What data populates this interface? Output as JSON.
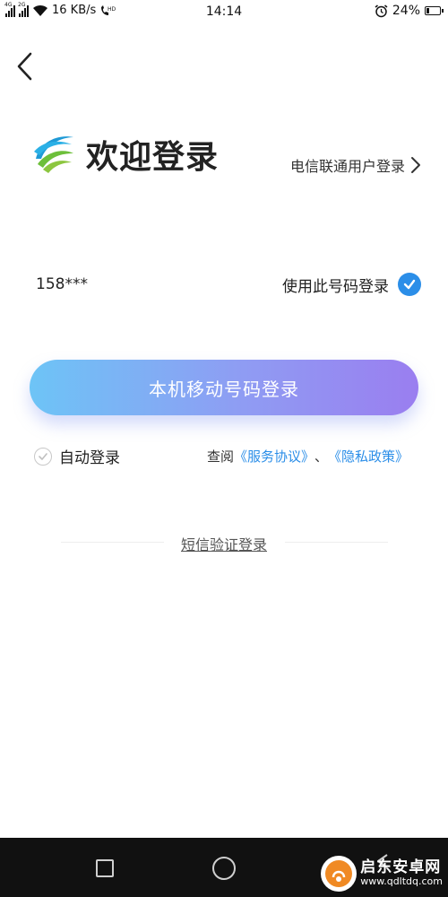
{
  "status_bar": {
    "network_speed": "16 KB/s",
    "time": "14:14",
    "battery": "24%",
    "battery_level": 0.24,
    "sim1_tag": "4G",
    "sim2_tag": "2G",
    "volte_tag": "HD",
    "icons": [
      "signal-icon",
      "wifi-icon",
      "volte-icon",
      "alarm-icon",
      "battery-icon"
    ]
  },
  "header": {
    "back_icon": "back-arrow-icon",
    "logo_icon": "china-mobile-logo",
    "welcome_title": "欢迎登录",
    "other_carrier_login": "电信联通用户登录",
    "other_carrier_icon": "chevron-right-icon"
  },
  "phone": {
    "masked_number": "158***",
    "use_number_label": "使用此号码登录",
    "use_number_checked": true,
    "check_icon": "check-circle-icon"
  },
  "primary_button": {
    "label": "本机移动号码登录",
    "gradient": [
      "#6dc4f6",
      "#9a7ef0"
    ]
  },
  "options": {
    "auto_login_label": "自动登录",
    "auto_login_checked": true,
    "terms_prefix": "查阅",
    "terms_service": "《服务协议》",
    "terms_separator": "、",
    "terms_privacy": "《隐私政策》"
  },
  "sms_login": {
    "label": "短信验证登录"
  },
  "nav_bar": {
    "icons": [
      "recents-square-icon",
      "home-circle-icon",
      "back-triangle-icon"
    ]
  },
  "watermark": {
    "title": "启东安卓网",
    "url": "www.qdltdq.com"
  },
  "colors": {
    "accent_blue": "#2b8ee8",
    "nav_background": "#111111",
    "watermark_orange": "#f08a24"
  }
}
